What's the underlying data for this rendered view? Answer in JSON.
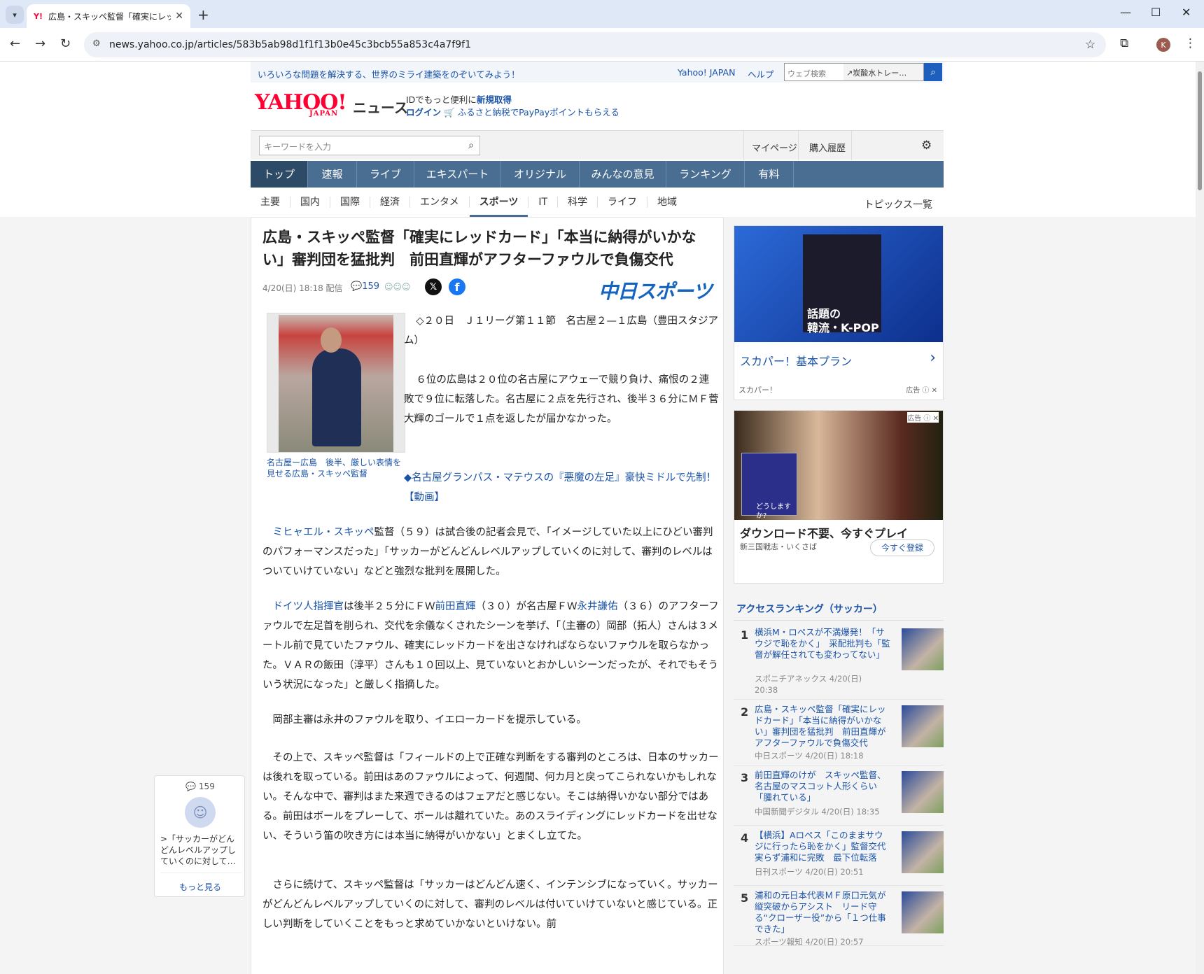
{
  "browser": {
    "tab_title": "広島・スキッペ監督「確実にレッドカ",
    "tab_favicon": "Y!",
    "url": "news.yahoo.co.jp/articles/583b5ab98d1f1f13b0e45c3bcb55a853c4a7f9f1",
    "profile_initial": "K"
  },
  "header": {
    "promo": "いろいろな問題を解決する、世界のミライ建築をのぞいてみよう！",
    "yahoo_japan": "Yahoo! JAPAN",
    "help": "ヘルプ",
    "web_search_placeholder": "ウェブ検索",
    "trend": "↗炭酸水トレー…",
    "logo": "YAHOO!",
    "logo_sub": "JAPAN",
    "news": "ニュース",
    "id_text": "IDでもっと便利に",
    "id_link": "新規取得",
    "login": "ログイン",
    "furusato": "ふるさと納税でPayPayポイントもらえる",
    "keyword_placeholder": "キーワードを入力",
    "mypage": "マイページ",
    "history": "購入履歴"
  },
  "gnav": [
    "トップ",
    "速報",
    "ライブ",
    "エキスパート",
    "オリジナル",
    "みんなの意見",
    "ランキング",
    "有料"
  ],
  "cnav": [
    "主要",
    "国内",
    "国際",
    "経済",
    "エンタメ",
    "スポーツ",
    "IT",
    "科学",
    "ライフ",
    "地域"
  ],
  "topics_all": "トピックス一覧",
  "article": {
    "title": "広島・スキッペ監督「確実にレッドカード」「本当に納得がいかない」審判団を猛批判　前田直輝がアフターファウルで負傷交代",
    "date": "4/20(日) 18:18 配信",
    "comments": "159",
    "source": "中日スポーツ",
    "caption": "名古屋ー広島　後半、厳しい表情を見せる広島・スキッペ監督",
    "p1": "◇２０日　Ｊ１リーグ第１１節　名古屋２—１広島（豊田スタジアム）",
    "p2": "６位の広島は２０位の名古屋にアウェーで競り負け、痛恨の２連敗で９位に転落した。名古屋に２点を先行され、後半３６分にＭＦ菅大輝のゴールで１点を返したが届かなかった。",
    "p3": "◆名古屋グランパス・マテウスの『悪魔の左足』豪快ミドルで先制！【動画】",
    "p4_link": "ミヒャエル・スキッペ",
    "p4": "監督（５９）は試合後の記者会見で、「イメージしていた以上にひどい審判のパフォーマンスだった」「サッカーがどんどんレベルアップしていくのに対して、審判のレベルはついていけていない」などと強烈な批判を展開した。",
    "p5_link1": "ドイツ人指揮官",
    "p5_a": "は後半２５分にＦＷ",
    "p5_link2": "前田直輝",
    "p5_b": "（３０）が名古屋ＦＷ",
    "p5_link3": "永井謙佑",
    "p5_c": "（３６）のアフターファウルで左足首を削られ、交代を余儀なくされたシーンを挙げ、「（主審の）岡部（拓人）さんは３メートル前で見ていたファウル、確実にレッドカードを出さなければならないファウルを取らなかった。ＶＡＲの飯田（淳平）さんも１０回以上、見ていないとおかしいシーンだったが、それでもそういう状況になった」と厳しく指摘した。",
    "p6": "岡部主審は永井のファウルを取り、イエローカードを提示している。",
    "p7": "その上で、スキッペ監督は「フィールドの上で正確な判断をする審判のところは、日本のサッカーは後れを取っている。前田はあのファウルによって、何週間、何カ月と戻ってこられないかもしれない。そんな中で、審判はまた来週できるのはフェアだと感じない。そこは納得いかない部分ではある。前田はボールをプレーして、ボールは離れていた。あのスライディングにレッドカードを出せない、そういう笛の吹き方には本当に納得がいかない」とまくし立てた。",
    "p8": "さらに続けて、スキッペ監督は「サッカーはどんどん速く、インテンシブになっていく。サッカーがどんどんレベルアップしていくのに対して、審判のレベルは付いていけていないと感じている。正しい判断をしていくことをもっと求めていかないといけない。前"
  },
  "float_comment": {
    "count": "159",
    "quote": ">「サッカーがどんどんレベルアップしていくのに対して…",
    "more": "もっと見る"
  },
  "ads": {
    "ad1_image_text": "話題の\n韓流・K-POP",
    "ad1_name": "スカパー！基本プラン",
    "ad1_sponsor": "スカパー！",
    "ad_label": "広告",
    "ad2_menu": "どうしますか?\n・撫摸\n・役降動告\n・尚策\n・追いやる\n・斬る",
    "ad2_headline": "ダウンロード不要、今すぐプレイ",
    "ad2_sponsor": "新三国戦志・いくさば",
    "ad2_button": "今すぐ登録"
  },
  "ranking": {
    "title": "アクセスランキング（サッカー）",
    "items": [
      {
        "n": "1",
        "title": "横浜M・ロペスが不満爆発！「サウジで恥をかく」　采配批判も「監督が解任されても変わってない」",
        "src": "スポニチアネックス 4/20(日) 20:38"
      },
      {
        "n": "2",
        "title": "広島・スキッペ監督「確実にレッドカード」「本当に納得がいかない」審判団を猛批判　前田直輝がアフターファウルで負傷交代",
        "src": "中日スポーツ 4/20(日) 18:18"
      },
      {
        "n": "3",
        "title": "前田直輝のけが　スキッペ監督、名古屋のマスコット人形くらい「腫れている」",
        "src": "中国新聞デジタル 4/20(日) 18:35"
      },
      {
        "n": "4",
        "title": "【横浜】Aロペス「このままサウジに行ったら恥をかく」監督交代実らず浦和に完敗　最下位転落",
        "src": "日刊スポーツ 4/20(日) 20:51"
      },
      {
        "n": "5",
        "title": "浦和の元日本代表ＭＦ原口元気が縦突破からアシスト　リード守る“クローザー役”から「１つ仕事できた」",
        "src": "スポーツ報知 4/20(日) 20:57"
      }
    ]
  }
}
